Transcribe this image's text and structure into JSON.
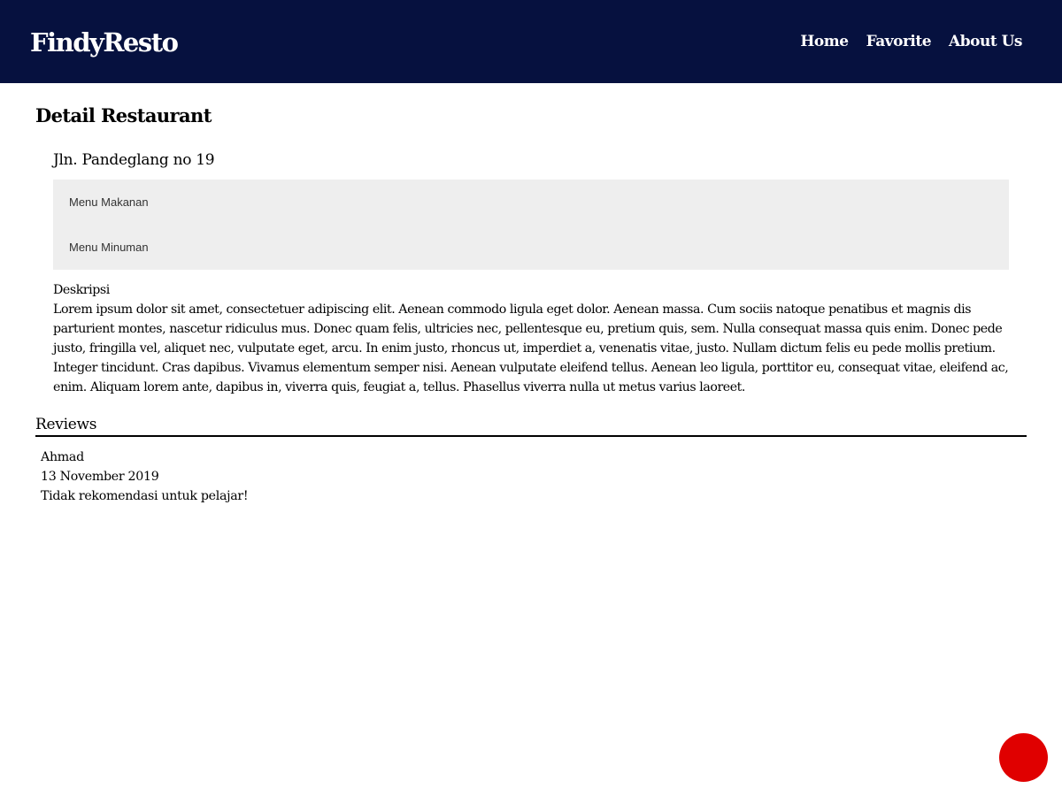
{
  "header": {
    "brand": "FindyResto",
    "nav": [
      {
        "label": "Home"
      },
      {
        "label": "Favorite"
      },
      {
        "label": "About Us"
      }
    ],
    "background_color": "#06113f"
  },
  "main": {
    "page_title": "Detail Restaurant",
    "address": "Jln. Pandeglang no 19",
    "menus": {
      "food_label": "Menu Makanan",
      "drink_label": "Menu Minuman"
    },
    "description": {
      "label": "Deskripsi",
      "text": "Lorem ipsum dolor sit amet, consectetuer adipiscing elit. Aenean commodo ligula eget dolor. Aenean massa. Cum sociis natoque penatibus et magnis dis parturient montes, nascetur ridiculus mus. Donec quam felis, ultricies nec, pellentesque eu, pretium quis, sem. Nulla consequat massa quis enim. Donec pede justo, fringilla vel, aliquet nec, vulputate eget, arcu. In enim justo, rhoncus ut, imperdiet a, venenatis vitae, justo. Nullam dictum felis eu pede mollis pretium. Integer tincidunt. Cras dapibus. Vivamus elementum semper nisi. Aenean vulputate eleifend tellus. Aenean leo ligula, porttitor eu, consequat vitae, eleifend ac, enim. Aliquam lorem ante, dapibus in, viverra quis, feugiat a, tellus. Phasellus viverra nulla ut metus varius laoreet."
    },
    "reviews": {
      "title": "Reviews",
      "items": [
        {
          "name": "Ahmad",
          "date": "13 November 2019",
          "review": "Tidak rekomendasi untuk pelajar!"
        }
      ]
    }
  },
  "favorite_button": {
    "color": "#e00000"
  }
}
